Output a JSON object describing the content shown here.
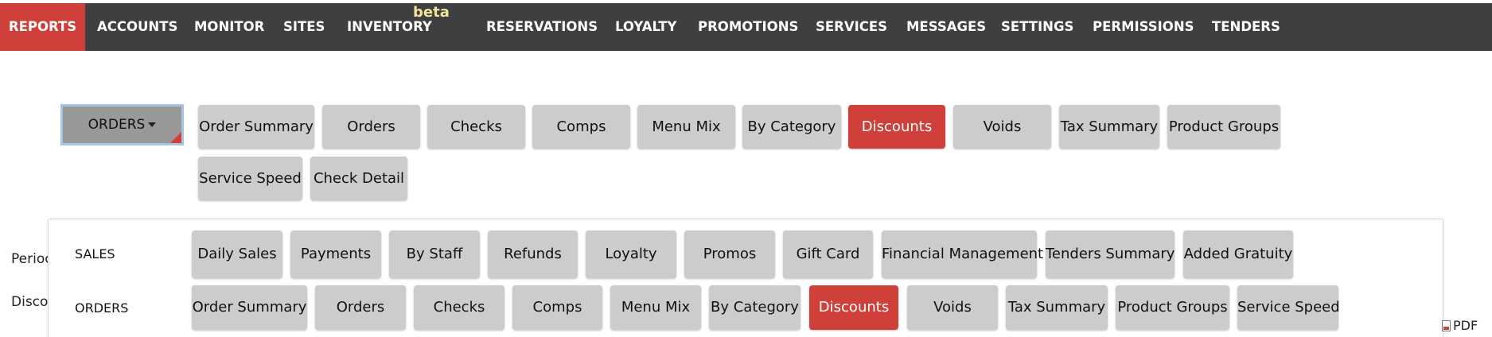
{
  "topnav": {
    "items": [
      {
        "label": "REPORTS",
        "active": true
      },
      {
        "label": "ACCOUNTS"
      },
      {
        "label": "MONITOR"
      },
      {
        "label": "SITES"
      },
      {
        "label": "INVENTORY",
        "badge": "beta"
      },
      {
        "label": "RESERVATIONS"
      },
      {
        "label": "LOYALTY"
      },
      {
        "label": "PROMOTIONS"
      },
      {
        "label": "SERVICES"
      },
      {
        "label": "MESSAGES"
      },
      {
        "label": "SETTINGS"
      },
      {
        "label": "PERMISSIONS"
      },
      {
        "label": "TENDERS"
      }
    ],
    "active_color": "#cf3f3a",
    "background": "#3f3f3f"
  },
  "report_bar": {
    "category_dropdown": "ORDERS",
    "tabs": [
      "Order Summary",
      "Orders",
      "Checks",
      "Comps",
      "Menu Mix",
      "By Category",
      "Discounts",
      "Voids",
      "Tax Summary",
      "Product Groups",
      "Service Speed",
      "Check Detail"
    ],
    "active_tab": "Discounts"
  },
  "background_labels": [
    "Perioc",
    "Discou"
  ],
  "dropdown_panel": {
    "sales": {
      "label": "SALES",
      "items": [
        "Daily Sales",
        "Payments",
        "By Staff",
        "Refunds",
        "Loyalty",
        "Promos",
        "Gift Card",
        "Financial Management",
        "Tenders Summary",
        "Added Gratuity"
      ]
    },
    "orders": {
      "label": "ORDERS",
      "items": [
        "Order Summary",
        "Orders",
        "Checks",
        "Comps",
        "Menu Mix",
        "By Category",
        "Discounts",
        "Voids",
        "Tax Summary",
        "Product Groups",
        "Service Speed"
      ],
      "active": "Discounts"
    }
  },
  "export": {
    "pdf_label": "PDF",
    "icon": "pdf-file-icon"
  },
  "colors": {
    "accent": "#d0403b",
    "pill": "#cccccc",
    "badge": "#f3e49d"
  }
}
